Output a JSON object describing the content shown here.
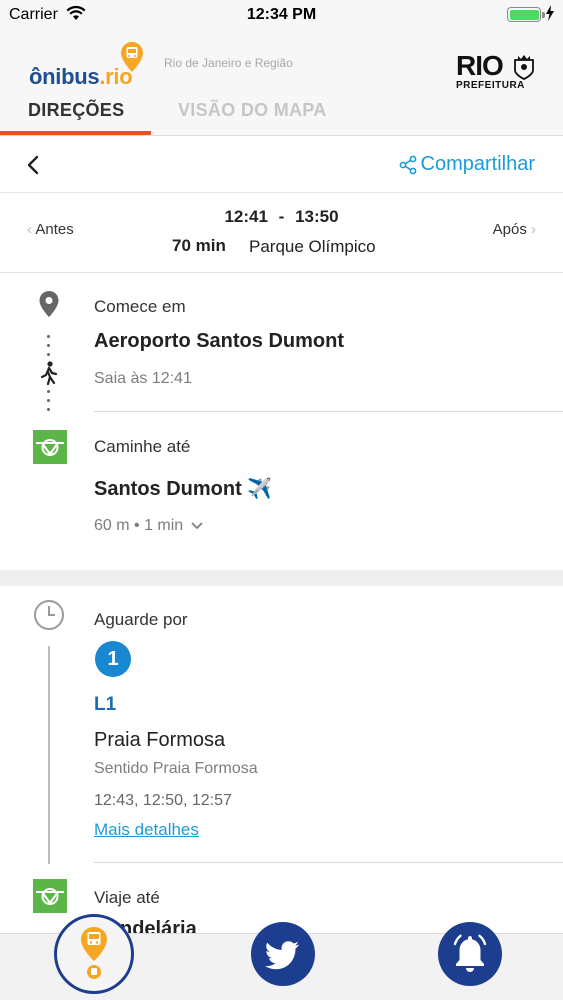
{
  "status_bar": {
    "carrier": "Carrier",
    "time": "12:34 PM",
    "wifi_icon": "wifi-icon",
    "battery_icon": "battery-icon",
    "charging_icon": "charging-bolt-icon"
  },
  "header": {
    "logo_text_main": "ônibus",
    "logo_text_dot": ".rio",
    "region": "Rio de Janeiro e Região",
    "brand_rio": "RIO",
    "brand_prefeitura": "PREFEITURA",
    "tabs": [
      {
        "label": "DIREÇÕES",
        "active": true
      },
      {
        "label": "VISÃO DO MAPA",
        "active": false
      }
    ],
    "accent_color": "#e8522b"
  },
  "nav": {
    "back_icon": "chevron-left-icon",
    "share_label": "Compartilhar",
    "share_icon": "share-icon"
  },
  "summary": {
    "prev_label": "Antes",
    "next_label": "Após",
    "depart": "12:41",
    "separator": "-",
    "arrive": "13:50",
    "duration": "70 min",
    "destination": "Parque Olímpico"
  },
  "steps": {
    "start": {
      "title": "Comece em",
      "name": "Aeroporto Santos Dumont",
      "sub": "Saia às 12:41",
      "icon": "location-pin-icon",
      "walk_icon": "walking-person-icon"
    },
    "walk": {
      "title": "Caminhe até",
      "name": "Santos Dumont ✈️",
      "sub": "60 m • 1 min",
      "icon": "vlt-station-icon",
      "expand_icon": "chevron-down-icon"
    },
    "wait": {
      "title": "Aguarde por",
      "icon": "clock-icon",
      "route_number": "1",
      "line_code": "L1",
      "route_name": "Praia Formosa",
      "direction": "Sentido Praia Formosa",
      "departures": "12:43, 12:50, 12:57",
      "details_link": "Mais detalhes",
      "route_color": "#1a87d1"
    },
    "ride": {
      "title": "Viaje até",
      "name_partial": "ndelária",
      "icon": "vlt-station-icon"
    }
  },
  "bottom_bar": {
    "items": [
      {
        "name": "bus-location-icon"
      },
      {
        "name": "twitter-icon"
      },
      {
        "name": "bell-icon"
      }
    ],
    "brand_color": "#1d3d8f"
  }
}
